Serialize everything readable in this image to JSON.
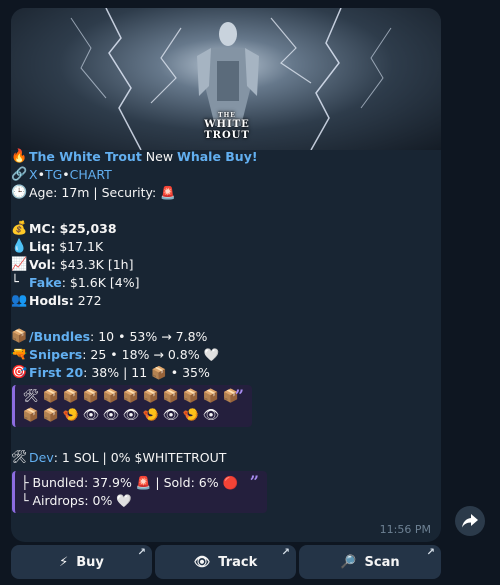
{
  "message": {
    "banner_logo_small": "THE",
    "banner_logo": "WHITE TROUT",
    "header": {
      "fire_emoji": "🔥",
      "token_name": "The White Trout",
      "mid": "New",
      "event": "Whale Buy!"
    },
    "links": {
      "emoji": "🔗",
      "x": "X",
      "sep1": "•",
      "tg": "TG",
      "sep2": "•",
      "chart": "CHART"
    },
    "age_line": {
      "emoji": "🕒",
      "text": "Age: 17m | Security:",
      "badge": "🚨"
    },
    "mc": {
      "emoji": "💰",
      "label": "MC:",
      "value": "$25,038"
    },
    "liq": {
      "emoji": "💧",
      "label": "Liq:",
      "value": "$17.1K"
    },
    "vol": {
      "emoji": "📈",
      "label": "Vol:",
      "value": "$43.3K [1h]"
    },
    "fake": {
      "prefix": "└",
      "label": "Fake",
      "value": ": $1.6K [4%]"
    },
    "hodls": {
      "emoji": "👥",
      "label": "Hodls:",
      "value": "272"
    },
    "bundles": {
      "emoji": "📦",
      "label": "/Bundles",
      "value": ": 10 • 53% → 7.8%"
    },
    "snipers": {
      "emoji": "🔫",
      "label": "Snipers",
      "value": ": 25 • 18% → 0.8%",
      "end": "🤍"
    },
    "first20": {
      "emoji": "🎯",
      "label": "First 20",
      "value": ": 38% | 11",
      "box": "📦",
      "value2": "• 35%"
    },
    "holders_quote": {
      "row1": [
        "🛠",
        "📦",
        "📦",
        "📦",
        "📦",
        "📦",
        "📦",
        "📦",
        "📦",
        "📦",
        "📦"
      ],
      "row2": [
        "📦",
        "📦",
        "🍤",
        "👁",
        "👁",
        "👁",
        "🍤",
        "👁",
        "🍤",
        "👁"
      ]
    },
    "dev": {
      "emoji": "🛠",
      "label": "Dev",
      "value": ": 1 SOL | 0% $WHITETROUT"
    },
    "dev_quote": {
      "bundled": "├ Bundled: 37.9%",
      "bundled_badge": "🚨",
      "sold": "| Sold: 6%",
      "sold_badge": "🔴",
      "airdrops": "└ Airdrops: 0%",
      "airdrops_badge": "🤍"
    },
    "time": "11:56 PM"
  },
  "keyboard": [
    {
      "icon": "⚡",
      "label": "Buy"
    },
    {
      "icon": "👁",
      "label": "Track"
    },
    {
      "icon": "🔎",
      "label": "Scan"
    }
  ],
  "colors": {
    "bg": "#0e1621",
    "bubble": "#182533",
    "link": "#62aff0",
    "quote_border": "#8c6ce0"
  }
}
